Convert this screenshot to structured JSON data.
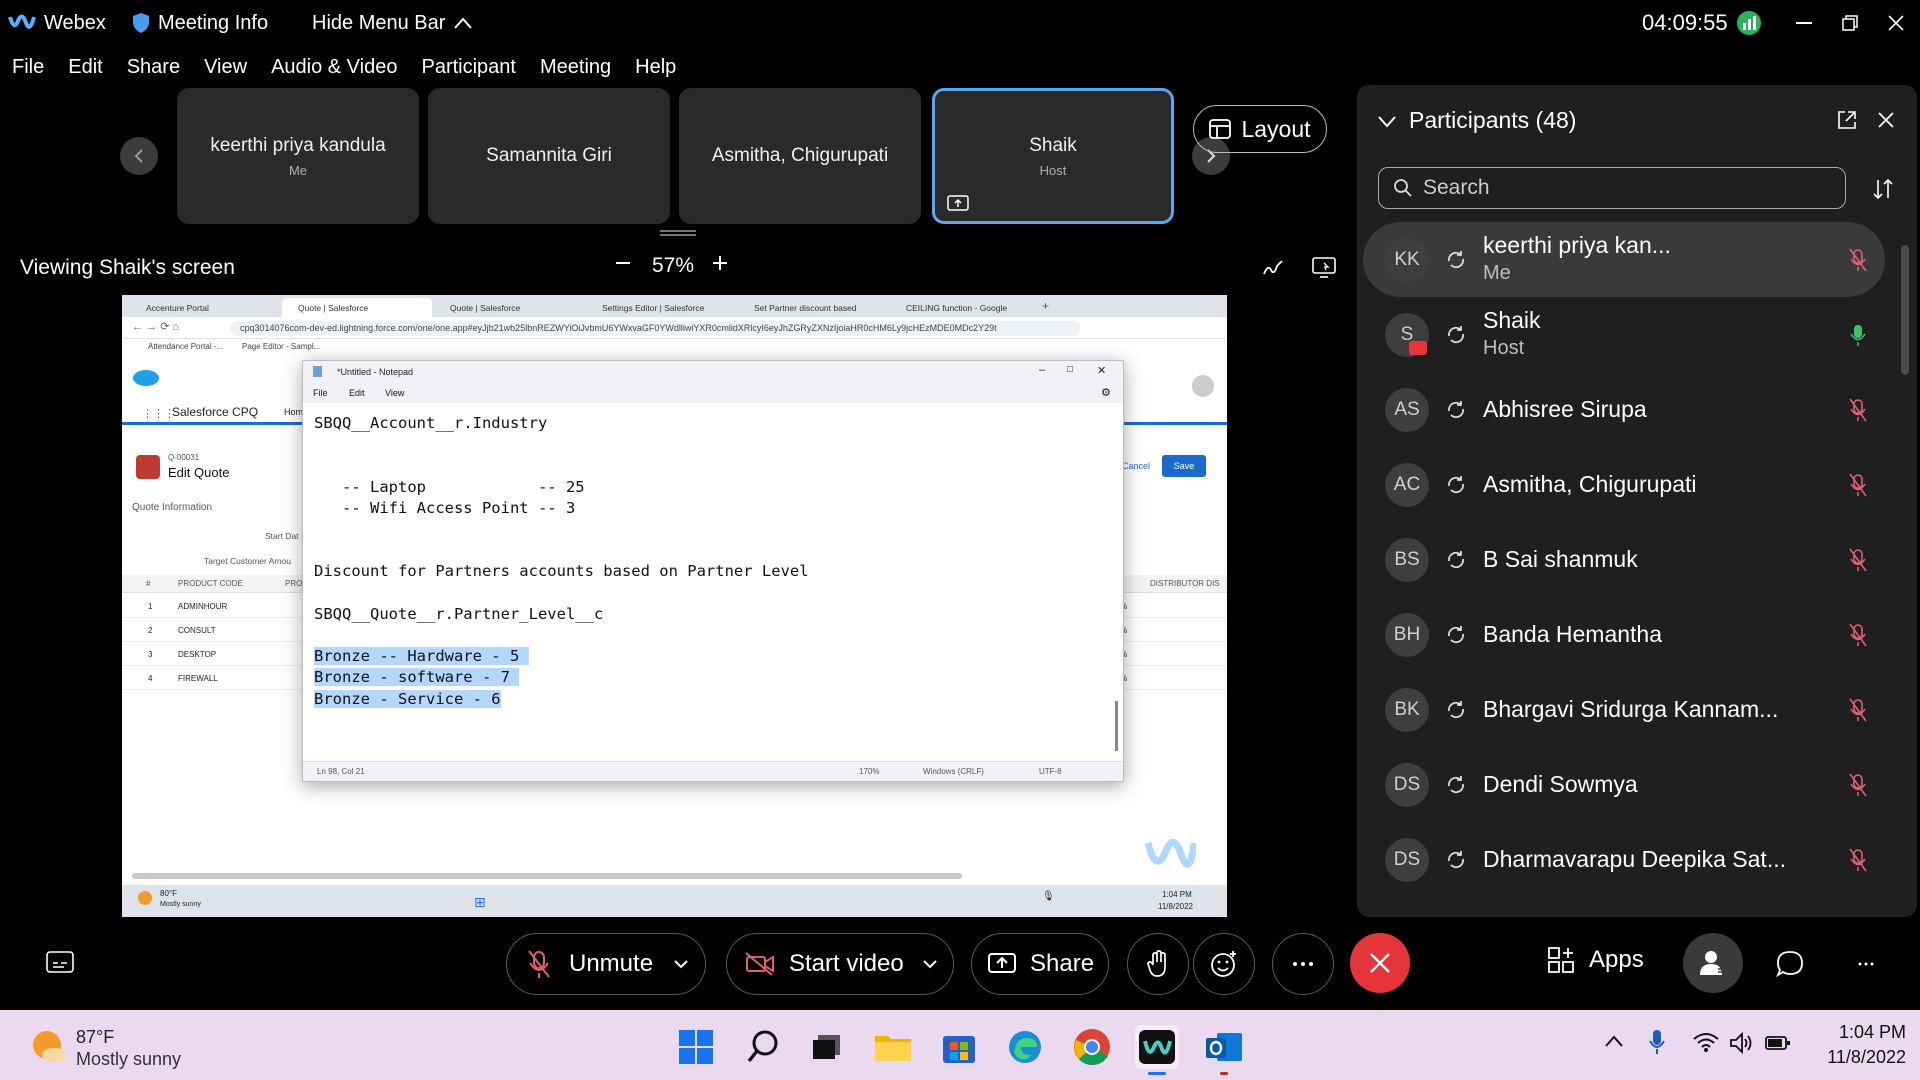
{
  "titlebar": {
    "app": "Webex",
    "meeting_info": "Meeting Info",
    "hide_menu": "Hide Menu Bar",
    "time": "04:09:55"
  },
  "menu": [
    "File",
    "Edit",
    "Share",
    "View",
    "Audio & Video",
    "Participant",
    "Meeting",
    "Help"
  ],
  "filmstrip": [
    {
      "name": "keerthi priya kandula",
      "sub": "Me"
    },
    {
      "name": "Samannita Giri",
      "sub": ""
    },
    {
      "name": "Asmitha, Chigurupati",
      "sub": ""
    },
    {
      "name": "Shaik",
      "sub": "Host"
    }
  ],
  "layout_label": "Layout",
  "viewing": "Viewing Shaik's screen",
  "zoom": "57%",
  "shared": {
    "tabs": [
      "Accenture Portal",
      "Quote | Salesforce",
      "Quote | Salesforce",
      "Settings Editor | Salesforce",
      "Set Partner discount based",
      "CEILING function - Google"
    ],
    "url": "cpq3014076com-dev-ed.lightning.force.com/one/one.app#eyJjb21wb25lbnREZWYiOiJvbmU6YWxvaGF0YWdlliwiYXR0cmlidXRlcyI6eyJhZGRyZXNzIjoiaHR0cHM6Ly9jcHEzMDE0MDc2Y29t",
    "bookmarks": [
      "Attendance Portal -...",
      "Page Editor - Sampl..."
    ],
    "app_name": "Salesforce CPQ",
    "home": "Hom",
    "quote_id": "Q-00031",
    "quote_title": "Edit Quote",
    "quote_info": "Quote Information",
    "start_date": "Start Dat",
    "target_amount": "Target Customer Amou",
    "cancel": "Cancel",
    "save": "Save",
    "table_headers": [
      "#",
      "PRODUCT CODE",
      "PRO",
      "DISTRIBUTOR DIS"
    ],
    "rows": [
      {
        "n": "1",
        "code": "ADMINHOUR"
      },
      {
        "n": "2",
        "code": "CONSULT"
      },
      {
        "n": "3",
        "code": "DESKTOP"
      },
      {
        "n": "4",
        "code": "FIREWALL"
      }
    ],
    "pct": "%",
    "notepad": {
      "title": "*Untitled - Notepad",
      "menu": [
        "File",
        "Edit",
        "View"
      ],
      "lines_plain": "SBQQ__Account__r.Industry\n\n\n   -- Laptop            -- 25\n   -- Wifi Access Point -- 3\n\n\nDiscount for Partners accounts based on Partner Level\n\nSBQQ__Quote__r.Partner_Level__c\n\n",
      "lines_selected": [
        "Bronze -- Hardware - 5 ",
        "Bronze - software - 7 ",
        "Bronze - Service - 6"
      ],
      "status": [
        "Ln 98, Col 21",
        "170%",
        "Windows (CRLF)",
        "UTF-8"
      ]
    },
    "mini_weather": [
      "80°F",
      "Mostly sunny"
    ],
    "mini_clock": [
      "1:04 PM",
      "11/8/2022"
    ]
  },
  "participants": {
    "title": "Participants (48)",
    "search_placeholder": "Search",
    "list": [
      {
        "initials": "KK",
        "name": "keerthi priya kan...",
        "sub": "Me"
      },
      {
        "initials": "S",
        "name": "Shaik",
        "sub": "Host"
      },
      {
        "initials": "AS",
        "name": "Abhisree Sirupa",
        "sub": ""
      },
      {
        "initials": "AC",
        "name": "Asmitha, Chigurupati",
        "sub": ""
      },
      {
        "initials": "BS",
        "name": "B Sai shanmuk",
        "sub": ""
      },
      {
        "initials": "BH",
        "name": "Banda Hemantha",
        "sub": ""
      },
      {
        "initials": "BK",
        "name": "Bhargavi Sridurga Kannam...",
        "sub": ""
      },
      {
        "initials": "DS",
        "name": "Dendi Sowmya",
        "sub": ""
      },
      {
        "initials": "DS",
        "name": "Dharmavarapu Deepika Sat...",
        "sub": ""
      }
    ]
  },
  "controls": {
    "unmute": "Unmute",
    "start_video": "Start video",
    "share": "Share",
    "apps": "Apps"
  },
  "taskbar": {
    "temp": "87°F",
    "weather": "Mostly sunny",
    "time": "1:04 PM",
    "date": "11/8/2022"
  },
  "colors": {
    "end_call": "#e5343a",
    "accent_border": "#5aa8f0",
    "muted_mic": "#e06070",
    "active_mic": "#3ec46d",
    "selection": "#b3d7ff"
  }
}
